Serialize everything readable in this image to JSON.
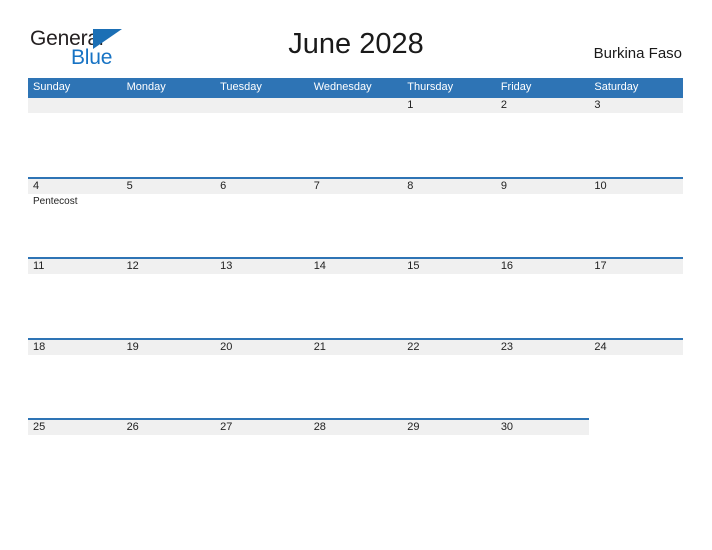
{
  "brand": {
    "name_part1": "General",
    "name_part2": "Blue",
    "flag_icon": "flag-triangle-icon"
  },
  "header": {
    "title": "June 2028",
    "country": "Burkina Faso"
  },
  "calendar": {
    "month": "June",
    "year": "2028",
    "day_headers": [
      "Sunday",
      "Monday",
      "Tuesday",
      "Wednesday",
      "Thursday",
      "Friday",
      "Saturday"
    ],
    "colors": {
      "header_blue": "#2e74b5",
      "band_gray": "#f0f0f0",
      "brand_blue": "#1773c4",
      "text_dark": "#222222"
    },
    "weeks": [
      {
        "band_columns": 7,
        "days": [
          {
            "date": "",
            "event": ""
          },
          {
            "date": "",
            "event": ""
          },
          {
            "date": "",
            "event": ""
          },
          {
            "date": "",
            "event": ""
          },
          {
            "date": "1",
            "event": ""
          },
          {
            "date": "2",
            "event": ""
          },
          {
            "date": "3",
            "event": ""
          }
        ]
      },
      {
        "band_columns": 7,
        "days": [
          {
            "date": "4",
            "event": "Pentecost"
          },
          {
            "date": "5",
            "event": ""
          },
          {
            "date": "6",
            "event": ""
          },
          {
            "date": "7",
            "event": ""
          },
          {
            "date": "8",
            "event": ""
          },
          {
            "date": "9",
            "event": ""
          },
          {
            "date": "10",
            "event": ""
          }
        ]
      },
      {
        "band_columns": 7,
        "days": [
          {
            "date": "11",
            "event": ""
          },
          {
            "date": "12",
            "event": ""
          },
          {
            "date": "13",
            "event": ""
          },
          {
            "date": "14",
            "event": ""
          },
          {
            "date": "15",
            "event": ""
          },
          {
            "date": "16",
            "event": ""
          },
          {
            "date": "17",
            "event": ""
          }
        ]
      },
      {
        "band_columns": 7,
        "days": [
          {
            "date": "18",
            "event": ""
          },
          {
            "date": "19",
            "event": ""
          },
          {
            "date": "20",
            "event": ""
          },
          {
            "date": "21",
            "event": ""
          },
          {
            "date": "22",
            "event": ""
          },
          {
            "date": "23",
            "event": ""
          },
          {
            "date": "24",
            "event": ""
          }
        ]
      },
      {
        "band_columns": 6,
        "days": [
          {
            "date": "25",
            "event": ""
          },
          {
            "date": "26",
            "event": ""
          },
          {
            "date": "27",
            "event": ""
          },
          {
            "date": "28",
            "event": ""
          },
          {
            "date": "29",
            "event": ""
          },
          {
            "date": "30",
            "event": ""
          },
          {
            "date": "",
            "event": ""
          }
        ]
      }
    ]
  }
}
